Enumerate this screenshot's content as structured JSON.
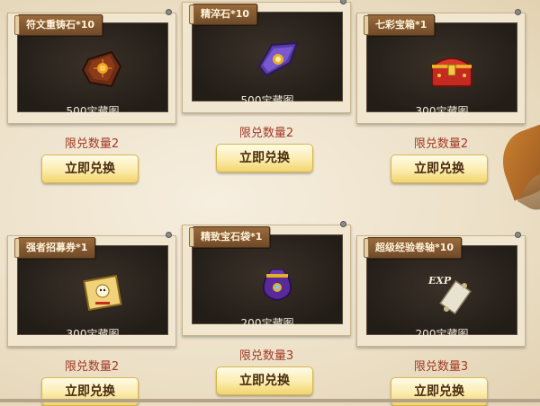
{
  "items": [
    {
      "name": "符文重铸石*10",
      "price": "500宝藏图",
      "limit": "限兑数量2",
      "button": "立即兑换",
      "icon": "rune-stone-icon"
    },
    {
      "name": "精淬石*10",
      "price": "500宝藏图",
      "limit": "限兑数量2",
      "button": "立即兑换",
      "icon": "purple-crystal-icon"
    },
    {
      "name": "七彩宝箱*1",
      "price": "300宝藏图",
      "limit": "限兑数量2",
      "button": "立即兑换",
      "icon": "treasure-chest-icon"
    },
    {
      "name": "强者招募券*1",
      "price": "300宝藏图",
      "limit": "限兑数量2",
      "button": "立即兑换",
      "icon": "recruit-scroll-icon"
    },
    {
      "name": "精致宝石袋*1",
      "price": "200宝藏图",
      "limit": "限兑数量3",
      "button": "立即兑换",
      "icon": "gem-bag-icon"
    },
    {
      "name": "超级经验卷轴*10",
      "price": "200宝藏图",
      "limit": "限兑数量3",
      "button": "立即兑换",
      "icon": "exp-scroll-icon"
    }
  ],
  "colors": {
    "limit_text": "#a23a26",
    "button_bg": "#fbecae",
    "panel_bg": "#231d18"
  }
}
